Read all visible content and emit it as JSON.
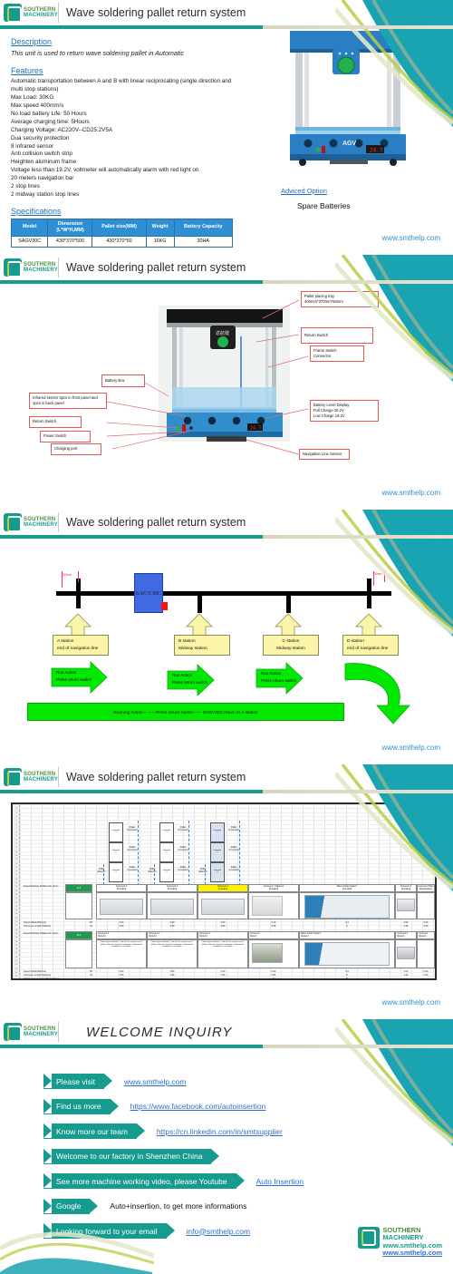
{
  "brand": {
    "logo_line1": "SOUTHERN",
    "logo_line2": "MACHINERY",
    "website": "www.smthelp.com",
    "accent_teal": "#169b8e",
    "accent_green": "#b9cc45",
    "accent_blue": "#2f8fd4"
  },
  "slide1": {
    "header_title": "Wave soldering pallet return system",
    "description_heading": "Description",
    "description_text": "This unit is used  to  return wave soldering pallet  in Automatic",
    "features_heading": "Features",
    "features": [
      "Automatic transportation between A and B with linear  reciprocating (single direction and multi  stop stations)",
      "Max Load: 30KG",
      "Max speed  400mm/s",
      "No load battery Life: 50 Hours",
      "Average charging time: 5Hours",
      "Charging Voltage: AC220V--CD25.2V5A",
      "Dua security protection",
      "8 infrared sensor",
      "Anti collision switch strip",
      "Heighten aluminum frame",
      "Voltage less than 19.2V, voltmeter will automatically alarm with red light on.",
      "20 meters navigation bar",
      "2 stop lines",
      "2 midway station stop lines"
    ],
    "spec_heading": "Specifications",
    "spec_columns": [
      "Model",
      "Dimension (L*W*H,MM)",
      "Pallet size(MM)",
      "Weight",
      "Battery Capacity"
    ],
    "spec_rows": [
      [
        "SAGV30C",
        "430*370*500",
        "430*370*50",
        "16KG",
        "30HA"
      ]
    ],
    "advice_heading": "Adviced Option",
    "advice_text": "Spare Batteries",
    "footer_url": "www.smthelp.com",
    "machine_label": "AGV"
  },
  "slide2": {
    "header_title": "Wave soldering pallet return system",
    "callouts": [
      "Pallet placing tray\n400mm*370mm*50mm",
      "Return Switch",
      "Battery Box",
      "Frame Switch\nConnector",
      "Infrared sensor 4pcs in front panel and 4pcs in back panel",
      "Battery Level Display\nFull Charge 25.2V\nLow Charge 19.2V",
      "Return Switch",
      "Power Switch",
      "Charging port",
      "Navigation Line Sensor"
    ],
    "callout_list": [
      {
        "id": "pallet-placing-tray",
        "text": "Pallet placing tray 400mm*370mm*50mm"
      },
      {
        "id": "return-switch-top",
        "text": "Return Switch"
      },
      {
        "id": "battery-box",
        "text": "Battery Box"
      },
      {
        "id": "frame-switch-connector",
        "text": "Frame Switch Connector"
      },
      {
        "id": "infrared-sensor",
        "text": "Infrared sensor 4pcs in front panel and 4pcs in back panel"
      },
      {
        "id": "battery-level-display",
        "text": "Battery Level Display Full Charge 25.2V Low Charge 19.2V"
      },
      {
        "id": "return-switch",
        "text": "Return Switch"
      },
      {
        "id": "power-switch",
        "text": "Power Switch"
      },
      {
        "id": "charging-port",
        "text": "Charging port"
      },
      {
        "id": "navigation-line-sensor",
        "text": "Navigation Line Sensor"
      }
    ],
    "footer_url": "www.smthelp.com"
  },
  "slide3": {
    "header_title": "Wave soldering pallet return system",
    "agv_label": "SAGV30C",
    "distance_left": "30cm",
    "distance_right": "30cm",
    "stations": [
      {
        "name": "A station",
        "desc": "end of navigation line"
      },
      {
        "name": "B station",
        "desc": "Midway station"
      },
      {
        "name": "C station",
        "desc": "Midway station"
      },
      {
        "name": "D station",
        "desc": "end of navigation line"
      }
    ],
    "actions": [
      {
        "line1": "Run Action",
        "line2": "Press return switch"
      },
      {
        "line1": "Run Action",
        "line2": "Press return switch"
      },
      {
        "line1": "Run Action",
        "line2": "Press return switch"
      }
    ],
    "summary_bar": "Running Action－－－Press return switch－－ SAGV30C return to A station",
    "footer_url": "www.smthelp.com"
  },
  "slide4": {
    "header_title": "Wave soldering pallet return system",
    "row_labels_top": [
      "Expected Rate (Pallets Per Hour)",
      "Speed (Meter/Minute)",
      "Conveyor Length (Meters)"
    ],
    "row_labels_bottom": [
      "Expected Rate (Pallets Per Hour)",
      "Speed (Meter/Minute)",
      "Conveyor Length (Meters)",
      "Distance in per hour (Meters/hour)",
      "Pallet Length (Meters) with 0.1m space between pallets",
      "Balance % By Segment",
      "Pallets Quantity By Segment",
      "Time elapsed until wave solder (seconds)"
    ],
    "expected_rate_value": "112",
    "forward_stations": [
      {
        "name": "Conveyor 3",
        "dir": "(Forward)"
      },
      {
        "name": "Conveyor 2",
        "dir": "(Forward)"
      },
      {
        "name": "Conveyor 1",
        "dir": "(Forward)"
      },
      {
        "name": "Conveyor 7 Adjacent",
        "dir": "(Forward)"
      },
      {
        "name": "Wave Solder System",
        "dir": "(Forward)"
      },
      {
        "name": "Conveyor 4",
        "dir": "(Forward)"
      },
      {
        "name": "Conveyor Pallet",
        "dir": "(Downloader)"
      }
    ],
    "return_stations": [
      {
        "name": "Conveyor 3",
        "dir": "(Return)"
      },
      {
        "name": "Conveyor 2",
        "dir": "(Return)"
      },
      {
        "name": "Conveyor 1",
        "dir": "(Return)"
      },
      {
        "name": "Conveyor",
        "dir": "Return"
      },
      {
        "name": "Wave Solder System",
        "dir": "(Return)"
      },
      {
        "name": "Conveyor 4",
        "dir": "(Return)"
      },
      {
        "name": "Conveyor",
        "dir": "(Return)"
      }
    ],
    "pallet_notes": [
      "Pallet selector  Model_3 and lifter to support up to 3 pallets. Selection based on magnetic configuration installed on each pallet.",
      "Pallet selector  Model_2 and lifter to support up to 2 pallets. Selection based on magnetic configuration installed on each pallet.",
      "Pallet selector  Model_1 and lifter to support up to 3 pallets. Selection based on magnetic configuration installed on each pallet."
    ],
    "operator_labels": [
      "Operator 1",
      "Operator 2",
      "Operator 3"
    ],
    "pallet_forward_label": "Pallet (Forward)",
    "pallet_return_label": "Pallet (Return)",
    "speed_values_top": [
      "2.00",
      "2.00",
      "2.00",
      "0.40",
      "0.4",
      "2.00",
      "0.00"
    ],
    "length_values_top": [
      "2.50",
      "2.50",
      "2.50",
      "0.55",
      "0",
      "2.40",
      "0.00"
    ],
    "speed_values_bottom": [
      "2.00",
      "2.00",
      "2.00",
      "0.00",
      "0.4",
      "2.00",
      "0.00"
    ],
    "length_values_bottom": [
      "2.50",
      "2.50",
      "2.50",
      "0.55",
      "0",
      "2.40",
      "0.00"
    ],
    "distance_values": [
      "120",
      "",
      "",
      "24",
      "24",
      "",
      ""
    ],
    "balance_values": [
      "30%",
      "30%",
      "30%"
    ],
    "pallet_qty_values": [
      "63",
      "54",
      "56"
    ],
    "elapsed_values": [
      "57.1428571",
      "26.6666667",
      "32.7272727"
    ],
    "extra_numbers": [
      "0.40",
      "100%",
      "112",
      "16.0066",
      "210",
      "1.50007",
      "989.7142857",
      "133",
      "107.1428571",
      "110",
      "1:28",
      "32.7272727",
      "1.77111",
      "84.08571428"
    ],
    "left_values": [
      "0.40",
      "100%",
      "112",
      "16.0066"
    ],
    "footer_url": "www.smthelp.com"
  },
  "slide5": {
    "header_title": "WELCOME INQUIRY",
    "rows": [
      {
        "label": "Please visit",
        "value": "www.smthelp.com",
        "link": true
      },
      {
        "label": "Find us more",
        "value": "https://www.facebook.com/autoinsertion",
        "link": true
      },
      {
        "label": "Know more our team",
        "value": "https://cn.linkedin.com/in/smtsupplier",
        "link": true
      },
      {
        "label": "Welcome to our factory in Shenzhen China",
        "value": "",
        "link": false
      },
      {
        "label": "See more machine working video, please Youtube",
        "value": "Auto Insertion",
        "link": true
      },
      {
        "label": "Google",
        "value": "Auto+insertion, to get more informations",
        "link": false
      },
      {
        "label": "Looking forward to your email",
        "value": "info@smthelp.com",
        "link": true
      }
    ],
    "footer_logo_line1": "SOUTHERN",
    "footer_logo_line2": "MACHINERY",
    "footer_url1": "www.smthelp.com",
    "footer_url2": "www.smthelp.com"
  }
}
